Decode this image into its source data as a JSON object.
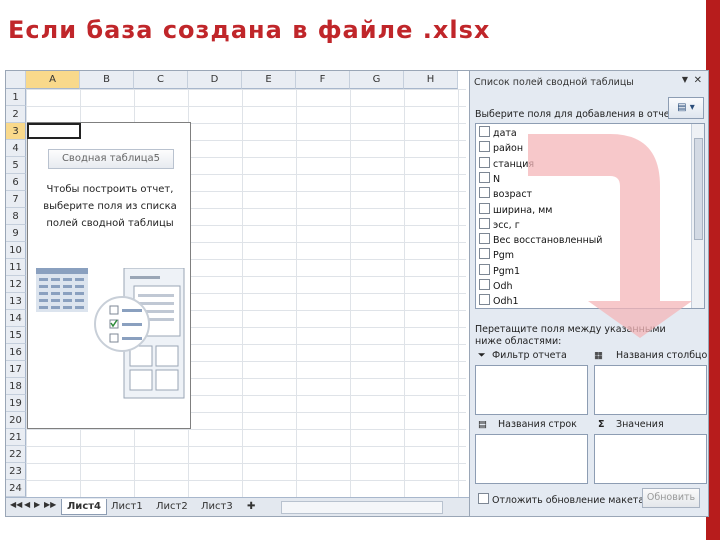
{
  "slide": {
    "title": "Если база создана в файле .xlsx"
  },
  "excel": {
    "columns": [
      "A",
      "B",
      "C",
      "D",
      "E",
      "F",
      "G",
      "H"
    ],
    "rows": [
      "1",
      "2",
      "3",
      "4",
      "5",
      "6",
      "7",
      "8",
      "9",
      "10",
      "11",
      "12",
      "13",
      "14",
      "15",
      "16",
      "17",
      "18",
      "19",
      "20",
      "21",
      "22",
      "23",
      "24"
    ],
    "selected_column": "A",
    "selected_row": "3",
    "pivot_placeholder": {
      "button_label": "Сводная таблица5",
      "instruction": "Чтобы построить отчет, выберите поля из списка полей сводной таблицы"
    },
    "sheet_tabs": [
      "Лист4",
      "Лист1",
      "Лист2",
      "Лист3"
    ],
    "active_tab": "Лист4",
    "nav_buttons": [
      "◀◀",
      "◀",
      "▶",
      "▶▶"
    ]
  },
  "field_panel": {
    "title": "Список полей сводной таблицы",
    "choose_label": "Выберите поля для добавления в отчет:",
    "fields": [
      "дата",
      "район",
      "станция",
      "N",
      "возраст",
      "ширина, мм",
      "эсс, г",
      "Вес восстановленный",
      "Pgm",
      "Pgm1",
      "Odh",
      "Odh1"
    ],
    "drag_label": "Перетащите поля между указанными ниже областями:",
    "areas": {
      "report_filter": "Фильтр отчета",
      "column_labels": "Названия столбцов",
      "row_labels": "Названия строк",
      "values": "Значения"
    },
    "defer_label": "Отложить обновление макета",
    "update_button": "Обновить"
  },
  "colors": {
    "accent": "#c0262a",
    "arrow": "#f4b6b8",
    "selection": "#f9d98b"
  },
  "icons": [
    "close-icon",
    "dropdown-icon",
    "layout-icon",
    "filter-icon",
    "columns-icon",
    "rows-icon",
    "sigma-icon",
    "arrow-curve-icon"
  ]
}
